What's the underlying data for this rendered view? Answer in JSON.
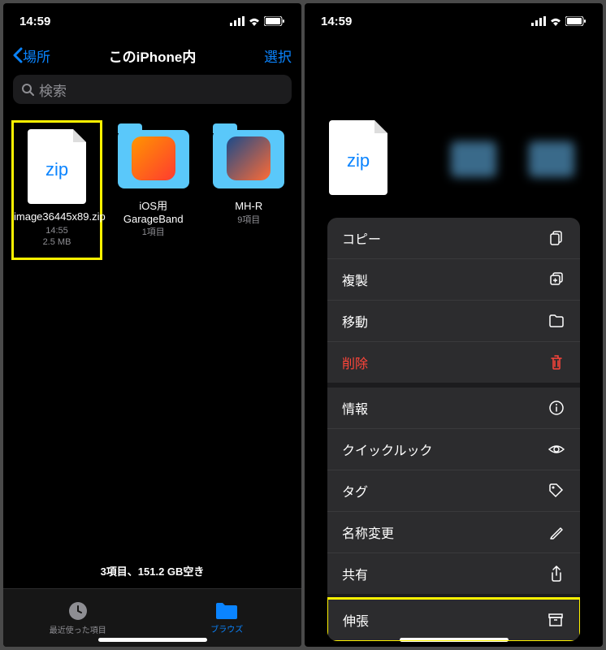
{
  "statusBar": {
    "time": "14:59"
  },
  "leftPhone": {
    "nav": {
      "back": "場所",
      "title": "このiPhone内",
      "action": "選択"
    },
    "search": {
      "placeholder": "検索"
    },
    "items": [
      {
        "name": "image36445x89.zip",
        "time": "14:55",
        "size": "2.5 MB",
        "zipLabel": "zip"
      },
      {
        "name": "iOS用\nGarageBand",
        "meta": "1項目"
      },
      {
        "name": "MH-R",
        "meta": "9項目"
      }
    ],
    "footer": "3項目、151.2 GB空き",
    "tabs": {
      "recent": "最近使った項目",
      "browse": "ブラウズ"
    }
  },
  "rightPhone": {
    "contextFile": {
      "zipLabel": "zip"
    },
    "menu": [
      {
        "label": "コピー",
        "icon": "copy"
      },
      {
        "label": "複製",
        "icon": "duplicate"
      },
      {
        "label": "移動",
        "icon": "folder"
      },
      {
        "label": "削除",
        "icon": "trash",
        "destructive": true,
        "spaced": true
      },
      {
        "label": "情報",
        "icon": "info"
      },
      {
        "label": "クイックルック",
        "icon": "eye"
      },
      {
        "label": "タグ",
        "icon": "tag"
      },
      {
        "label": "名称変更",
        "icon": "pencil"
      },
      {
        "label": "共有",
        "icon": "share",
        "spaced": true
      },
      {
        "label": "伸張",
        "icon": "archive",
        "highlighted": true
      }
    ]
  }
}
